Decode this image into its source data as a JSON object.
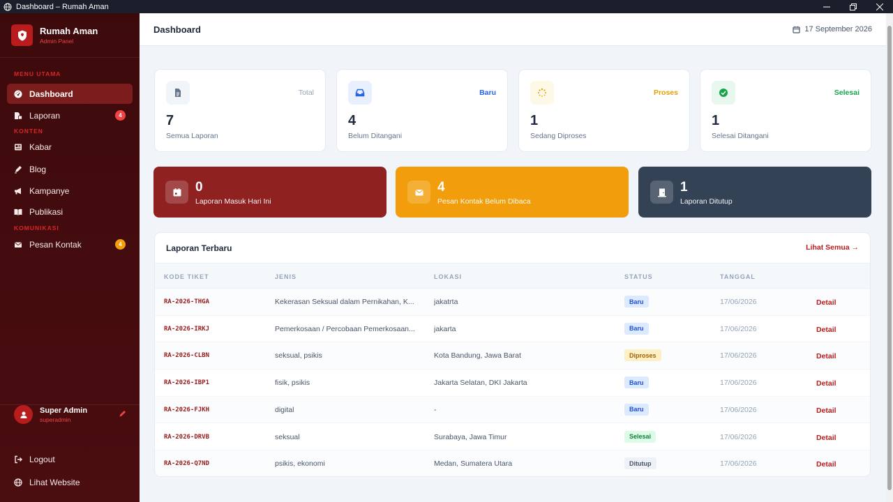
{
  "window": {
    "title": "Dashboard – Rumah Aman"
  },
  "brand": {
    "name": "Rumah Aman",
    "subtitle": "Admin Panel"
  },
  "sidebar": {
    "sections": {
      "main": "MENU UTAMA",
      "content": "KONTEN",
      "communication": "KOMUNIKASI"
    },
    "items": [
      {
        "label": "Dashboard",
        "icon": "dashboard-icon",
        "active": true
      },
      {
        "label": "Laporan",
        "icon": "report-icon",
        "badge": "4",
        "badge_color": "#ef4444"
      },
      {
        "label": "Kabar",
        "icon": "news-icon"
      },
      {
        "label": "Blog",
        "icon": "blog-icon"
      },
      {
        "label": "Kampanye",
        "icon": "megaphone-icon"
      },
      {
        "label": "Publikasi",
        "icon": "book-icon"
      },
      {
        "label": "Pesan Kontak",
        "icon": "envelope-icon",
        "badge": "4",
        "badge_color": "#f59e0b"
      }
    ],
    "user": {
      "name": "Super Admin",
      "handle": "superadmin"
    },
    "footer_links": [
      {
        "label": "Logout",
        "icon": "logout-icon"
      },
      {
        "label": "Lihat Website",
        "icon": "globe-icon"
      }
    ]
  },
  "header": {
    "title": "Dashboard",
    "date": "17 September 2026"
  },
  "stats": [
    {
      "tag": "Total",
      "tag_color": "#94a3b8",
      "value": "7",
      "label": "Semua Laporan",
      "icon": "document-icon",
      "icon_bg": "#f1f5f9",
      "icon_color": "#64748b"
    },
    {
      "tag": "Baru",
      "tag_color": "#2563eb",
      "value": "4",
      "label": "Belum Ditangani",
      "icon": "inbox-icon",
      "icon_bg": "#e8f0fe",
      "icon_color": "#2563eb"
    },
    {
      "tag": "Proses",
      "tag_color": "#e3a008",
      "value": "1",
      "label": "Sedang Diproses",
      "icon": "spinner-icon",
      "icon_bg": "#fef9e7",
      "icon_color": "#e3a008"
    },
    {
      "tag": "Selesai",
      "tag_color": "#16a34a",
      "value": "1",
      "label": "Selesai Ditangani",
      "icon": "check-circle-icon",
      "icon_bg": "#e8f8ee",
      "icon_color": "#16a34a"
    }
  ],
  "highlights": [
    {
      "value": "0",
      "label": "Laporan Masuk Hari Ini",
      "icon": "calendar-icon",
      "bg": "#8f2121"
    },
    {
      "value": "4",
      "label": "Pesan Kontak Belum Dibaca",
      "icon": "envelope-icon",
      "bg": "#f29e0c"
    },
    {
      "value": "1",
      "label": "Laporan Ditutup",
      "icon": "door-closed-icon",
      "bg": "#344256"
    }
  ],
  "recent": {
    "title": "Laporan Terbaru",
    "view_all": "Lihat Semua →",
    "columns": [
      "KODE TIKET",
      "JENIS",
      "LOKASI",
      "STATUS",
      "TANGGAL"
    ],
    "rows": [
      {
        "code": "RA-2026-THGA",
        "type": "Kekerasan Seksual dalam Pernikahan, K...",
        "location": "jakatrta",
        "status": "Baru",
        "date": "17/06/2026",
        "action": "Detail"
      },
      {
        "code": "RA-2026-IRKJ",
        "type": "Pemerkosaan / Percobaan Pemerkosaan...",
        "location": "jakarta",
        "status": "Baru",
        "date": "17/06/2026",
        "action": "Detail"
      },
      {
        "code": "RA-2026-CLBN",
        "type": "seksual, psikis",
        "location": "Kota Bandung, Jawa Barat",
        "status": "Diproses",
        "date": "17/06/2026",
        "action": "Detail"
      },
      {
        "code": "RA-2026-IBP1",
        "type": "fisik, psikis",
        "location": "Jakarta Selatan, DKI Jakarta",
        "status": "Baru",
        "date": "17/06/2026",
        "action": "Detail"
      },
      {
        "code": "RA-2026-FJKH",
        "type": "digital",
        "location": "-",
        "status": "Baru",
        "date": "17/06/2026",
        "action": "Detail"
      },
      {
        "code": "RA-2026-DRVB",
        "type": "seksual",
        "location": "Surabaya, Jawa Timur",
        "status": "Selesai",
        "date": "17/06/2026",
        "action": "Detail"
      },
      {
        "code": "RA-2026-Q7ND",
        "type": "psikis, ekonomi",
        "location": "Medan, Sumatera Utara",
        "status": "Ditutup",
        "date": "17/06/2026",
        "action": "Detail"
      }
    ]
  },
  "status_colors": {
    "Baru": {
      "bg": "#dbeafe",
      "fg": "#1d4ed8"
    },
    "Diproses": {
      "bg": "#fdf0c4",
      "fg": "#a16207"
    },
    "Selesai": {
      "bg": "#dcfce7",
      "fg": "#15803d"
    },
    "Ditutup": {
      "bg": "#eef1f5",
      "fg": "#475569"
    }
  }
}
